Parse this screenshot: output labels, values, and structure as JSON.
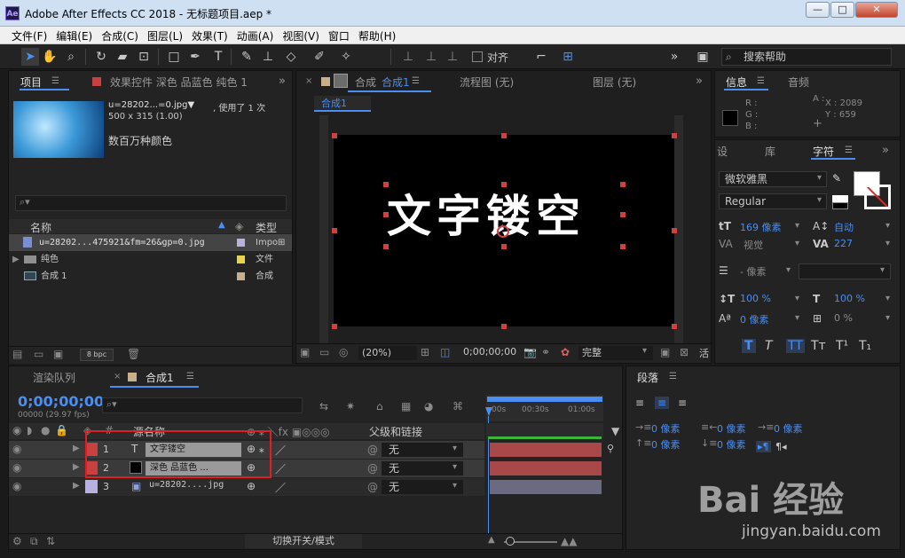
{
  "window": {
    "title": "Adobe After Effects CC 2018 - 无标题项目.aep *",
    "app_icon": "Ae",
    "min": "—",
    "max": "□",
    "close": "✕"
  },
  "menu": [
    "文件(F)",
    "编辑(E)",
    "合成(C)",
    "图层(L)",
    "效果(T)",
    "动画(A)",
    "视图(V)",
    "窗口",
    "帮助(H)"
  ],
  "toolbar": {
    "snap_label": "对齐",
    "search_placeholder": "搜索帮助"
  },
  "project_panel": {
    "tab": "项目",
    "effects_tab": "效果控件 深色 品蓝色 纯色 1",
    "asset_name": "u=28202...=0.jpg▼",
    "asset_usage": ", 使用了 1 次",
    "asset_dims": "500 x 315 (1.00)",
    "asset_colors": "数百万种颜色",
    "search_placeholder": "",
    "col_name": "名称",
    "col_type": "类型",
    "items": [
      {
        "name": "u=28202...475921&fm=26&gp=0.jpg",
        "type": "Impo",
        "color": "#b7b0e0"
      },
      {
        "name": "纯色",
        "type": "文件",
        "color": "#e8d44a"
      },
      {
        "name": "合成 1",
        "type": "合成",
        "color": "#c9b08a"
      }
    ],
    "bpc": "8 bpc"
  },
  "comp_panel": {
    "tab": "合成",
    "tab_comp": "合成1",
    "flow_tab": "流程图 (无)",
    "layer_tab": "图层 (无)",
    "breadcrumb": "合成1",
    "text": "文字镂空",
    "zoom": "(20%)",
    "timecode": "0;00;00;00",
    "quality": "完整",
    "active_cam": "活"
  },
  "info_panel": {
    "tab": "信息",
    "audio_tab": "音频",
    "r": "R :",
    "g": "G :",
    "b": "B :",
    "a": "A :",
    "x": "X : 2089",
    "y": "Y : 659"
  },
  "char_panel": {
    "tab_settings": "设",
    "tab_lib": "库",
    "tab_char": "字符",
    "font": "微软雅黑",
    "style": "Regular",
    "size": "169 像素",
    "leading": "自动",
    "kerning": "视觉",
    "tracking": "227",
    "stroke_width": "- 像素",
    "vscale": "100 %",
    "hscale": "100 %",
    "baseline": "0 像素",
    "tsume": "0 %"
  },
  "para_panel": {
    "tab": "段落",
    "indent1": "0 像素",
    "indent2": "0 像素",
    "indent3": "0 像素",
    "space1": "0 像素",
    "space2": "0 像素"
  },
  "timeline": {
    "render_tab": "渲染队列",
    "comp_tab": "合成1",
    "timecode": "0;00;00;00",
    "frame_info": "00000 (29.97 fps)",
    "col_source": "源名称",
    "col_parent": "父级和链接",
    "rulers": [
      "00s",
      "00:30s",
      "01:00s"
    ],
    "layers": [
      {
        "num": "1",
        "type": "T",
        "name": "文字镂空",
        "parent": "无",
        "color": "#c84040"
      },
      {
        "num": "2",
        "type": "■",
        "name": "深色 品蓝色 ...",
        "parent": "无",
        "color": "#c84040"
      },
      {
        "num": "3",
        "type": "▣",
        "name": "u=28202....jpg",
        "parent": "无",
        "color": "#b7b0e0"
      }
    ],
    "bottom_label": "切换开关/模式"
  },
  "watermark": {
    "brand": "Bai 经验",
    "url": "jingyan.baidu.com"
  }
}
